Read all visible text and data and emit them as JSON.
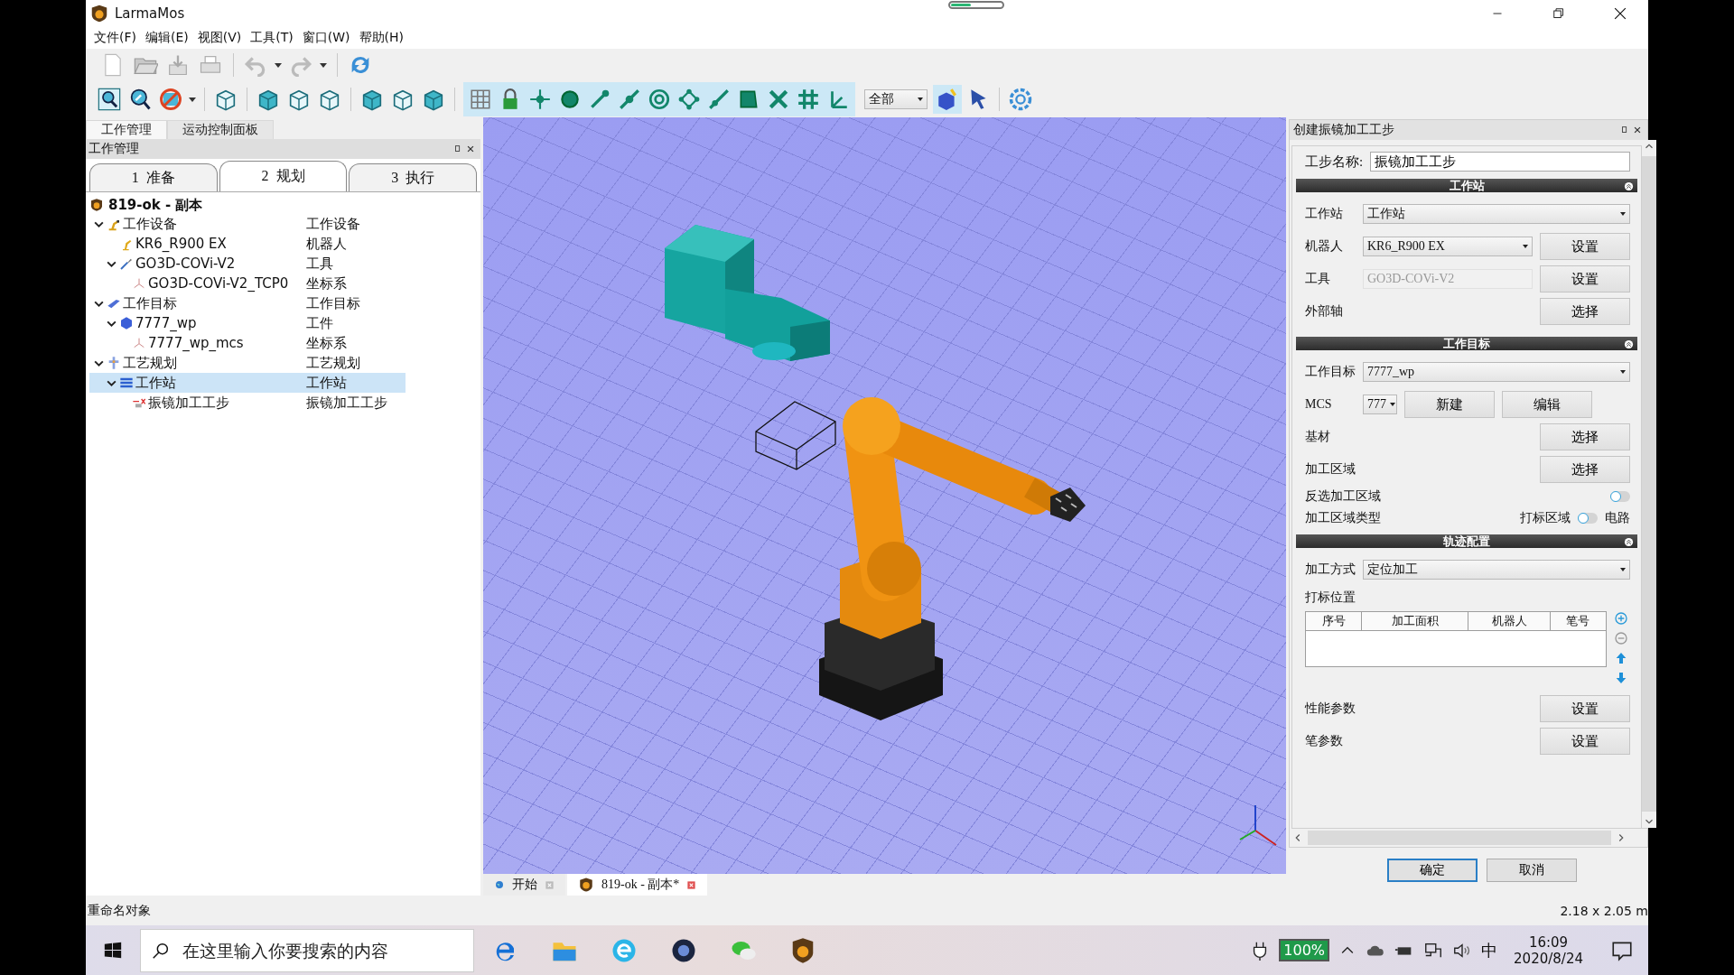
{
  "window": {
    "title": "LarmaMos"
  },
  "menu": [
    "文件(F)",
    "编辑(E)",
    "视图(V)",
    "工具(T)",
    "窗口(W)",
    "帮助(H)"
  ],
  "toolbar": {
    "filter_combo": {
      "value": "全部"
    }
  },
  "left_panel": {
    "tabs": [
      {
        "label": "工作管理",
        "selected": true
      },
      {
        "label": "运动控制面板",
        "selected": false
      }
    ],
    "title": "工作管理",
    "step_tabs": [
      {
        "label": "1  准备",
        "selected": false
      },
      {
        "label": "2  规划",
        "selected": true
      },
      {
        "label": "3  执行",
        "selected": false
      }
    ],
    "tree": {
      "root": "819-ok - 副本",
      "items": [
        {
          "kind": "equipment",
          "name": "工作设备",
          "type": "工作设备",
          "expanded": true,
          "selected": false,
          "children": [
            {
              "kind": "robot",
              "name": "KR6_R900 EX",
              "type": "机器人",
              "selected": false
            },
            {
              "kind": "tool",
              "name": "GO3D-COVi-V2",
              "type": "工具",
              "expanded": true,
              "selected": false,
              "children": [
                {
                  "kind": "frame",
                  "name": "GO3D-COVi-V2_TCP0",
                  "type": "坐标系",
                  "selected": false
                }
              ]
            }
          ]
        },
        {
          "kind": "target",
          "name": "工作目标",
          "type": "工作目标",
          "expanded": true,
          "selected": false,
          "children": [
            {
              "kind": "workpiece",
              "name": "7777_wp",
              "type": "工件",
              "expanded": true,
              "selected": false,
              "children": [
                {
                  "kind": "frame",
                  "name": "7777_wp_mcs",
                  "type": "坐标系",
                  "selected": false
                }
              ]
            }
          ]
        },
        {
          "kind": "process",
          "name": "工艺规划",
          "type": "工艺规划",
          "expanded": true,
          "selected": false,
          "children": [
            {
              "kind": "station",
              "name": "工作站",
              "type": "工作站",
              "expanded": true,
              "selected": true,
              "children": [
                {
                  "kind": "step",
                  "name": "振镜加工工步",
                  "type": "振镜加工工步",
                  "selected": false
                }
              ]
            }
          ]
        }
      ]
    }
  },
  "viewport": {
    "doc_tabs": [
      {
        "kind": "start",
        "label": "开始",
        "selected": false
      },
      {
        "kind": "project",
        "label": "819-ok - 副本*",
        "selected": true
      }
    ]
  },
  "right_panel": {
    "title": "创建振镜加工工步",
    "step_name": {
      "label": "工步名称:",
      "value": "振镜加工工步"
    },
    "sections": [
      {
        "title": "工作站",
        "rows": [
          {
            "kind": "combo",
            "label": "工作站",
            "value": "工作站"
          },
          {
            "kind": "combo",
            "label": "机器人",
            "value": "KR6_R900 EX",
            "buttons": [
              "设置"
            ]
          },
          {
            "kind": "field",
            "label": "工具",
            "value": "GO3D-COVi-V2",
            "disabled": true,
            "buttons": [
              "设置"
            ]
          },
          {
            "kind": "button",
            "label": "外部轴",
            "buttons": [
              "选择"
            ]
          }
        ]
      },
      {
        "title": "工作目标",
        "rows": [
          {
            "kind": "combo",
            "label": "工作目标",
            "value": "7777_wp"
          },
          {
            "kind": "combo",
            "label": "MCS",
            "value": "777",
            "buttons": [
              "新建",
              "编辑"
            ]
          },
          {
            "kind": "button",
            "label": "基材",
            "buttons": [
              "选择"
            ]
          },
          {
            "kind": "button",
            "label": "加工区域",
            "buttons": [
              "选择"
            ]
          },
          {
            "kind": "toggle",
            "label": "反选加工区域",
            "on": false
          },
          {
            "kind": "switch",
            "label": "加工区域类型",
            "left": "打标区域",
            "right": "电路",
            "on": false
          }
        ]
      },
      {
        "title": "轨迹配置",
        "rows": [
          {
            "kind": "combo",
            "label": "加工方式",
            "value": "定位加工"
          },
          {
            "kind": "label",
            "label": "打标位置"
          },
          {
            "kind": "table",
            "columns": [
              "序号",
              "加工面积",
              "机器人",
              "笔号"
            ]
          },
          {
            "kind": "button",
            "label": "性能参数",
            "buttons": [
              "设置"
            ]
          },
          {
            "kind": "button",
            "label": "笔参数",
            "buttons": [
              "设置"
            ]
          }
        ]
      }
    ],
    "footer_buttons": [
      {
        "label": "确定",
        "focused": true
      },
      {
        "label": "取消",
        "focused": false
      }
    ]
  },
  "status_bar": {
    "message": "重命名对象",
    "dimensions": "2.18 x 2.05 m"
  },
  "taskbar": {
    "search": {
      "placeholder": "在这里输入你要搜索的内容"
    },
    "battery": "100%",
    "ime": "中",
    "time": "16:09",
    "date": "2020/8/24"
  }
}
